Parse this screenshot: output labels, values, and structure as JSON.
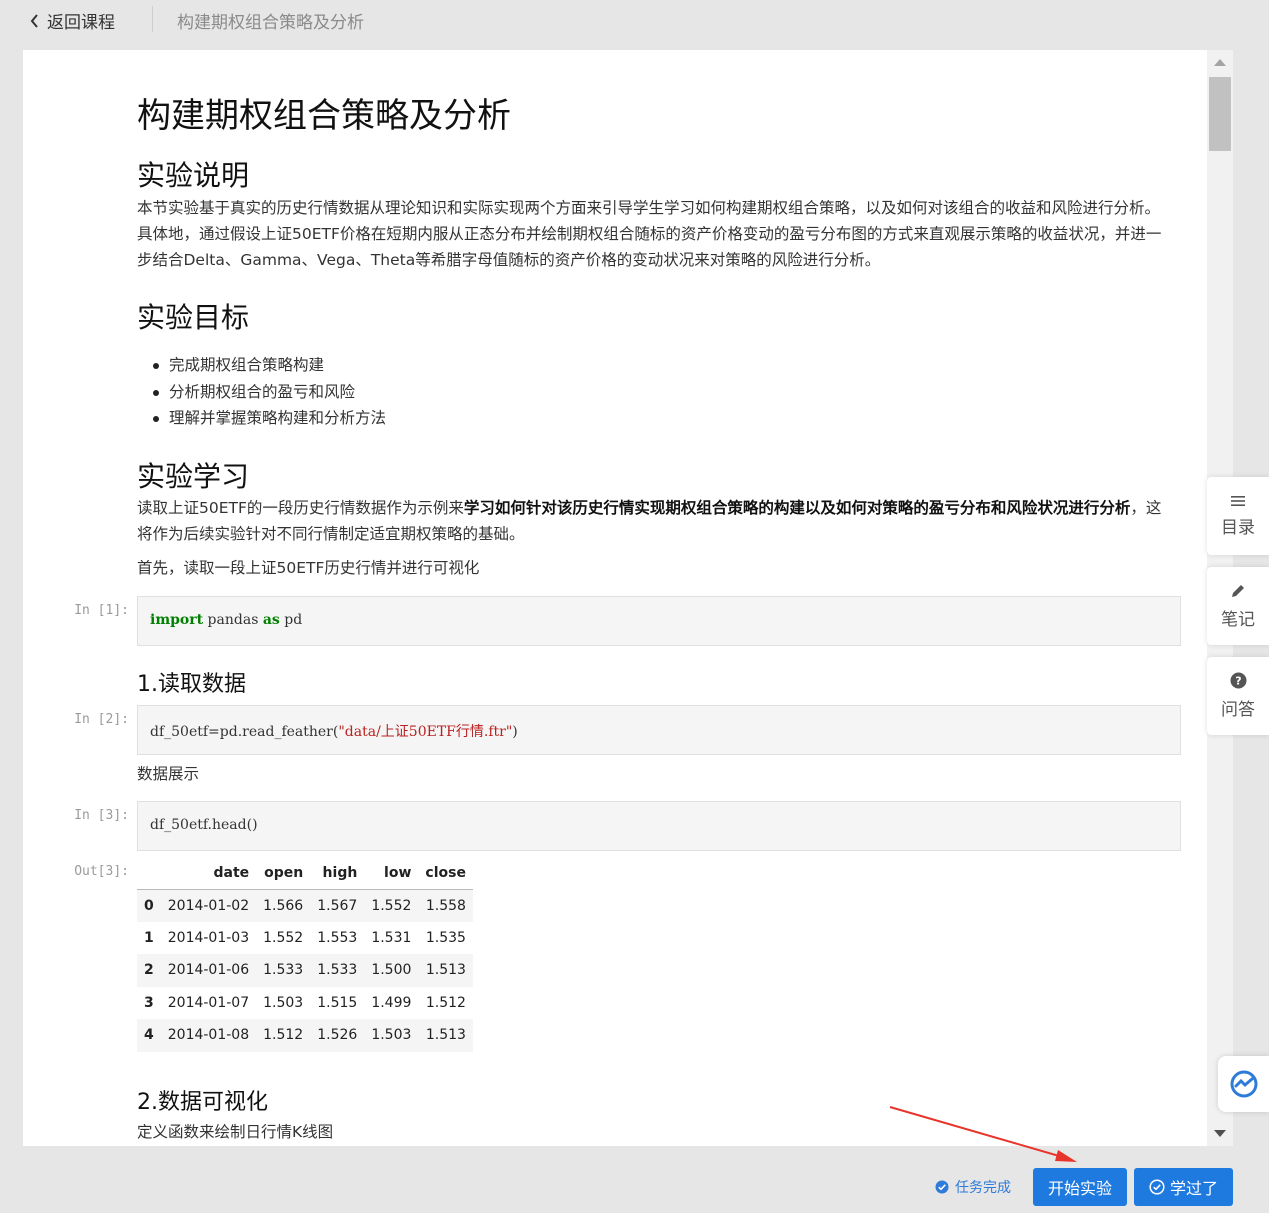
{
  "topbar": {
    "back_label": "返回课程",
    "page_title": "构建期权组合策略及分析"
  },
  "doc": {
    "title": "构建期权组合策略及分析",
    "section1": {
      "heading": "实验说明",
      "text": "本节实验基于真实的历史行情数据从理论知识和实际实现两个方面来引导学生学习如何构建期权组合策略，以及如何对该组合的收益和风险进行分析。具体地，通过假设上证50ETF价格在短期内服从正态分布并绘制期权组合随标的资产价格变动的盈亏分布图的方式来直观展示策略的收益状况，并进一步结合Delta、Gamma、Vega、Theta等希腊字母值随标的资产价格的变动状况来对策略的风险进行分析。"
    },
    "section2": {
      "heading": "实验目标",
      "items": [
        "完成期权组合策略构建",
        "分析期权组合的盈亏和风险",
        "理解并掌握策略构建和分析方法"
      ]
    },
    "section3": {
      "heading": "实验学习",
      "text_before": "读取上证50ETF的一段历史行情数据作为示例来",
      "text_bold": "学习如何针对该历史行情实现期权组合策略的构建以及如何对策略的盈亏分布和风险状况进行分析",
      "text_after": "，这将作为后续实验针对不同行情制定适宜期权策略的基础。",
      "text2": "首先，读取一段上证50ETF历史行情并进行可视化"
    },
    "cell1": {
      "prompt": "In  [1]:",
      "kw1": "import",
      "mid": " pandas ",
      "kw2": "as",
      "end": " pd"
    },
    "sub1": "1.读取数据",
    "cell2": {
      "prompt": "In  [2]:",
      "pre": "df_50etf=pd.read_feather(",
      "str": "\"data/上证50ETF行情.ftr\"",
      "post": ")"
    },
    "data_show": "数据展示",
    "cell3": {
      "prompt": "In  [3]:",
      "code": "df_50etf.head()"
    },
    "out3": {
      "prompt": "Out[3]:",
      "columns": [
        "",
        "date",
        "open",
        "high",
        "low",
        "close"
      ],
      "rows": [
        [
          "0",
          "2014-01-02",
          "1.566",
          "1.567",
          "1.552",
          "1.558"
        ],
        [
          "1",
          "2014-01-03",
          "1.552",
          "1.553",
          "1.531",
          "1.535"
        ],
        [
          "2",
          "2014-01-06",
          "1.533",
          "1.533",
          "1.500",
          "1.513"
        ],
        [
          "3",
          "2014-01-07",
          "1.503",
          "1.515",
          "1.499",
          "1.512"
        ],
        [
          "4",
          "2014-01-08",
          "1.512",
          "1.526",
          "1.503",
          "1.513"
        ]
      ]
    },
    "sub2": "2.数据可视化",
    "sub2_text": "定义函数来绘制日行情K线图"
  },
  "sidebar": {
    "toc_label": "目录",
    "notes_label": "笔记",
    "qa_label": "问答"
  },
  "actions": {
    "task_done_label": "任务完成",
    "start_label": "开始实验",
    "learned_label": "学过了"
  },
  "colors": {
    "accent": "#1f7ae0",
    "annotation_arrow": "#e8352b"
  }
}
